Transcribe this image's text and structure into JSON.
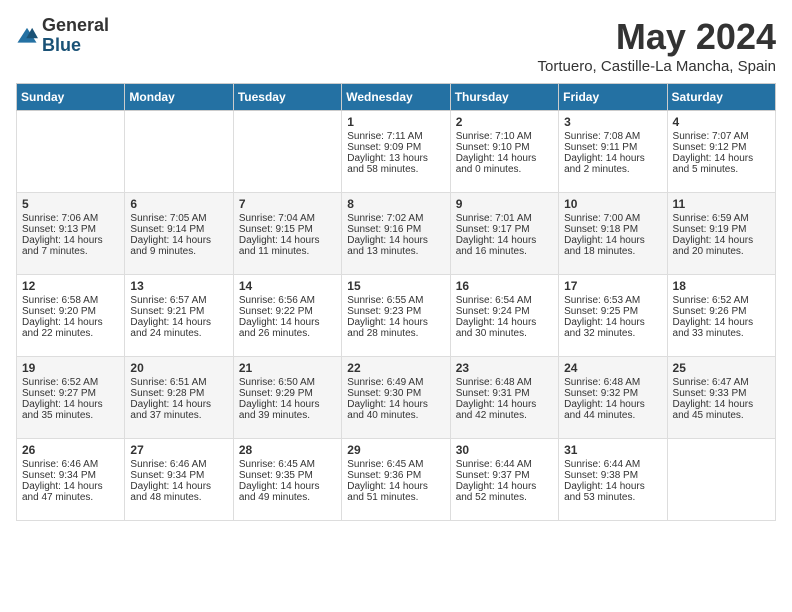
{
  "header": {
    "logo_general": "General",
    "logo_blue": "Blue",
    "month_title": "May 2024",
    "location": "Tortuero, Castille-La Mancha, Spain"
  },
  "weekdays": [
    "Sunday",
    "Monday",
    "Tuesday",
    "Wednesday",
    "Thursday",
    "Friday",
    "Saturday"
  ],
  "weeks": [
    [
      {
        "day": null,
        "data": null
      },
      {
        "day": null,
        "data": null
      },
      {
        "day": null,
        "data": null
      },
      {
        "day": "1",
        "data": [
          "Sunrise: 7:11 AM",
          "Sunset: 9:09 PM",
          "Daylight: 13 hours and 58 minutes."
        ]
      },
      {
        "day": "2",
        "data": [
          "Sunrise: 7:10 AM",
          "Sunset: 9:10 PM",
          "Daylight: 14 hours and 0 minutes."
        ]
      },
      {
        "day": "3",
        "data": [
          "Sunrise: 7:08 AM",
          "Sunset: 9:11 PM",
          "Daylight: 14 hours and 2 minutes."
        ]
      },
      {
        "day": "4",
        "data": [
          "Sunrise: 7:07 AM",
          "Sunset: 9:12 PM",
          "Daylight: 14 hours and 5 minutes."
        ]
      }
    ],
    [
      {
        "day": "5",
        "data": [
          "Sunrise: 7:06 AM",
          "Sunset: 9:13 PM",
          "Daylight: 14 hours and 7 minutes."
        ]
      },
      {
        "day": "6",
        "data": [
          "Sunrise: 7:05 AM",
          "Sunset: 9:14 PM",
          "Daylight: 14 hours and 9 minutes."
        ]
      },
      {
        "day": "7",
        "data": [
          "Sunrise: 7:04 AM",
          "Sunset: 9:15 PM",
          "Daylight: 14 hours and 11 minutes."
        ]
      },
      {
        "day": "8",
        "data": [
          "Sunrise: 7:02 AM",
          "Sunset: 9:16 PM",
          "Daylight: 14 hours and 13 minutes."
        ]
      },
      {
        "day": "9",
        "data": [
          "Sunrise: 7:01 AM",
          "Sunset: 9:17 PM",
          "Daylight: 14 hours and 16 minutes."
        ]
      },
      {
        "day": "10",
        "data": [
          "Sunrise: 7:00 AM",
          "Sunset: 9:18 PM",
          "Daylight: 14 hours and 18 minutes."
        ]
      },
      {
        "day": "11",
        "data": [
          "Sunrise: 6:59 AM",
          "Sunset: 9:19 PM",
          "Daylight: 14 hours and 20 minutes."
        ]
      }
    ],
    [
      {
        "day": "12",
        "data": [
          "Sunrise: 6:58 AM",
          "Sunset: 9:20 PM",
          "Daylight: 14 hours and 22 minutes."
        ]
      },
      {
        "day": "13",
        "data": [
          "Sunrise: 6:57 AM",
          "Sunset: 9:21 PM",
          "Daylight: 14 hours and 24 minutes."
        ]
      },
      {
        "day": "14",
        "data": [
          "Sunrise: 6:56 AM",
          "Sunset: 9:22 PM",
          "Daylight: 14 hours and 26 minutes."
        ]
      },
      {
        "day": "15",
        "data": [
          "Sunrise: 6:55 AM",
          "Sunset: 9:23 PM",
          "Daylight: 14 hours and 28 minutes."
        ]
      },
      {
        "day": "16",
        "data": [
          "Sunrise: 6:54 AM",
          "Sunset: 9:24 PM",
          "Daylight: 14 hours and 30 minutes."
        ]
      },
      {
        "day": "17",
        "data": [
          "Sunrise: 6:53 AM",
          "Sunset: 9:25 PM",
          "Daylight: 14 hours and 32 minutes."
        ]
      },
      {
        "day": "18",
        "data": [
          "Sunrise: 6:52 AM",
          "Sunset: 9:26 PM",
          "Daylight: 14 hours and 33 minutes."
        ]
      }
    ],
    [
      {
        "day": "19",
        "data": [
          "Sunrise: 6:52 AM",
          "Sunset: 9:27 PM",
          "Daylight: 14 hours and 35 minutes."
        ]
      },
      {
        "day": "20",
        "data": [
          "Sunrise: 6:51 AM",
          "Sunset: 9:28 PM",
          "Daylight: 14 hours and 37 minutes."
        ]
      },
      {
        "day": "21",
        "data": [
          "Sunrise: 6:50 AM",
          "Sunset: 9:29 PM",
          "Daylight: 14 hours and 39 minutes."
        ]
      },
      {
        "day": "22",
        "data": [
          "Sunrise: 6:49 AM",
          "Sunset: 9:30 PM",
          "Daylight: 14 hours and 40 minutes."
        ]
      },
      {
        "day": "23",
        "data": [
          "Sunrise: 6:48 AM",
          "Sunset: 9:31 PM",
          "Daylight: 14 hours and 42 minutes."
        ]
      },
      {
        "day": "24",
        "data": [
          "Sunrise: 6:48 AM",
          "Sunset: 9:32 PM",
          "Daylight: 14 hours and 44 minutes."
        ]
      },
      {
        "day": "25",
        "data": [
          "Sunrise: 6:47 AM",
          "Sunset: 9:33 PM",
          "Daylight: 14 hours and 45 minutes."
        ]
      }
    ],
    [
      {
        "day": "26",
        "data": [
          "Sunrise: 6:46 AM",
          "Sunset: 9:34 PM",
          "Daylight: 14 hours and 47 minutes."
        ]
      },
      {
        "day": "27",
        "data": [
          "Sunrise: 6:46 AM",
          "Sunset: 9:34 PM",
          "Daylight: 14 hours and 48 minutes."
        ]
      },
      {
        "day": "28",
        "data": [
          "Sunrise: 6:45 AM",
          "Sunset: 9:35 PM",
          "Daylight: 14 hours and 49 minutes."
        ]
      },
      {
        "day": "29",
        "data": [
          "Sunrise: 6:45 AM",
          "Sunset: 9:36 PM",
          "Daylight: 14 hours and 51 minutes."
        ]
      },
      {
        "day": "30",
        "data": [
          "Sunrise: 6:44 AM",
          "Sunset: 9:37 PM",
          "Daylight: 14 hours and 52 minutes."
        ]
      },
      {
        "day": "31",
        "data": [
          "Sunrise: 6:44 AM",
          "Sunset: 9:38 PM",
          "Daylight: 14 hours and 53 minutes."
        ]
      },
      {
        "day": null,
        "data": null
      }
    ]
  ]
}
